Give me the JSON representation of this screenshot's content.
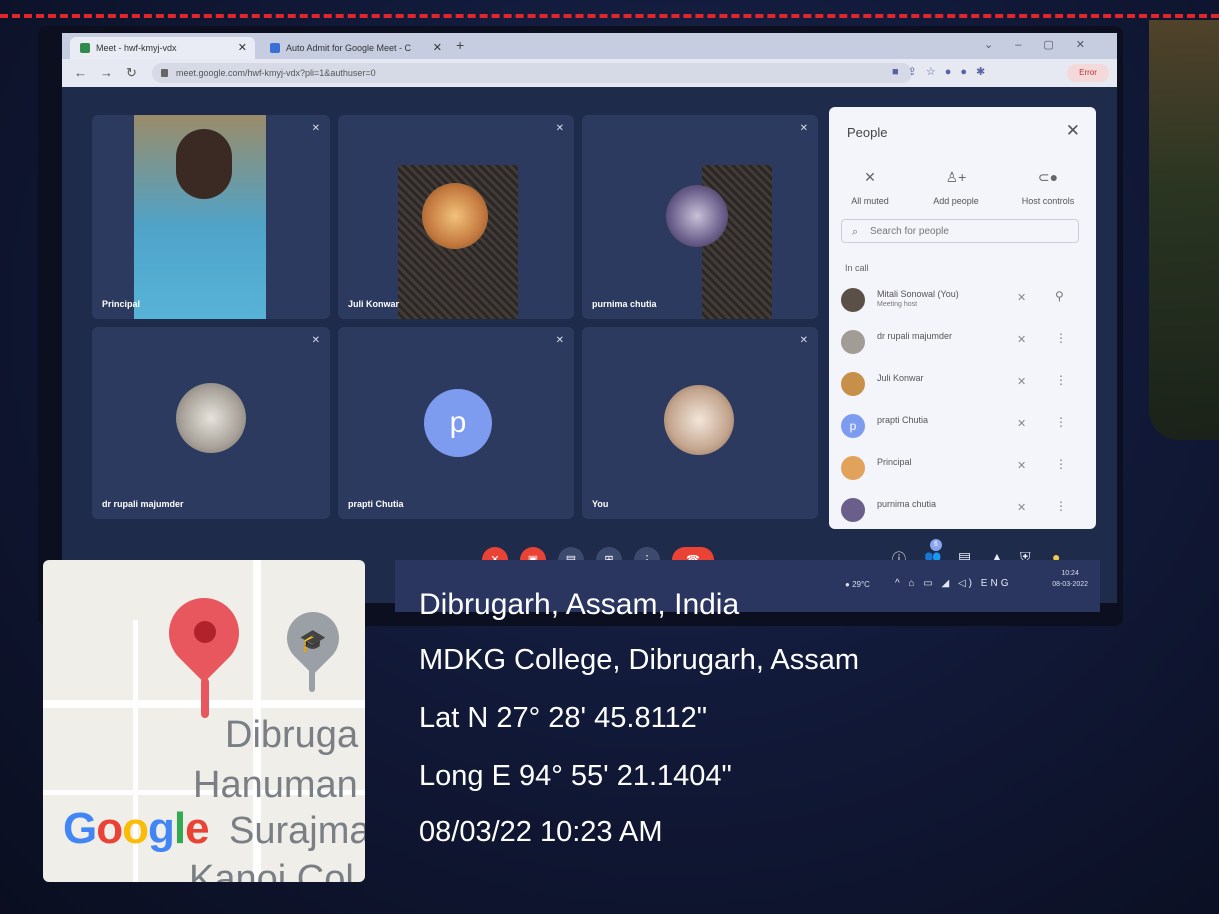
{
  "browser": {
    "tabs": [
      {
        "label": "Meet - hwf-kmyj-vdx"
      },
      {
        "label": "Auto Admit for Google Meet - C"
      }
    ],
    "url": "meet.google.com/hwf-kmyj-vdx?pli=1&authuser=0",
    "error_label": "Error"
  },
  "meet": {
    "tiles": [
      {
        "name": "Principal"
      },
      {
        "name": "Juli Konwar"
      },
      {
        "name": "purnima chutia"
      },
      {
        "name": "dr rupali majumder"
      },
      {
        "name": "prapti Chutia",
        "initial": "p"
      },
      {
        "name": "You"
      }
    ],
    "participants_badge": "6"
  },
  "people_panel": {
    "title": "People",
    "actions": [
      {
        "label": "All muted",
        "icon": "mic-off-icon"
      },
      {
        "label": "Add people",
        "icon": "add-person-icon"
      },
      {
        "label": "Host controls",
        "icon": "toggle-icon"
      }
    ],
    "search_placeholder": "Search for people",
    "section_label": "In call",
    "participants": [
      {
        "name": "Mitali Sonowal (You)",
        "sub": "Meeting host"
      },
      {
        "name": "dr rupali majumder"
      },
      {
        "name": "Juli Konwar"
      },
      {
        "name": "prapti Chutia",
        "initial": "p"
      },
      {
        "name": "Principal"
      },
      {
        "name": "purnima chutia"
      }
    ]
  },
  "taskbar": {
    "weather": "29°C",
    "lang": "ENG",
    "time": "10:24",
    "date": "08-03-2022"
  },
  "overlay": {
    "map_labels": [
      "Dibruga",
      "Hanuman",
      "Surajma",
      "Kanoi Col"
    ],
    "location": "Dibrugarh, Assam, India",
    "place": "MDKG College, Dibrugarh, Assam",
    "lat": "Lat N 27° 28' 45.8112\"",
    "long": "Long E 94° 55' 21.1404\"",
    "datetime": "08/03/22 10:23 AM"
  },
  "colors": {
    "accent_red": "#e8565e",
    "meet_red": "#ea4335",
    "avatar_blue": "#7d9bef"
  }
}
